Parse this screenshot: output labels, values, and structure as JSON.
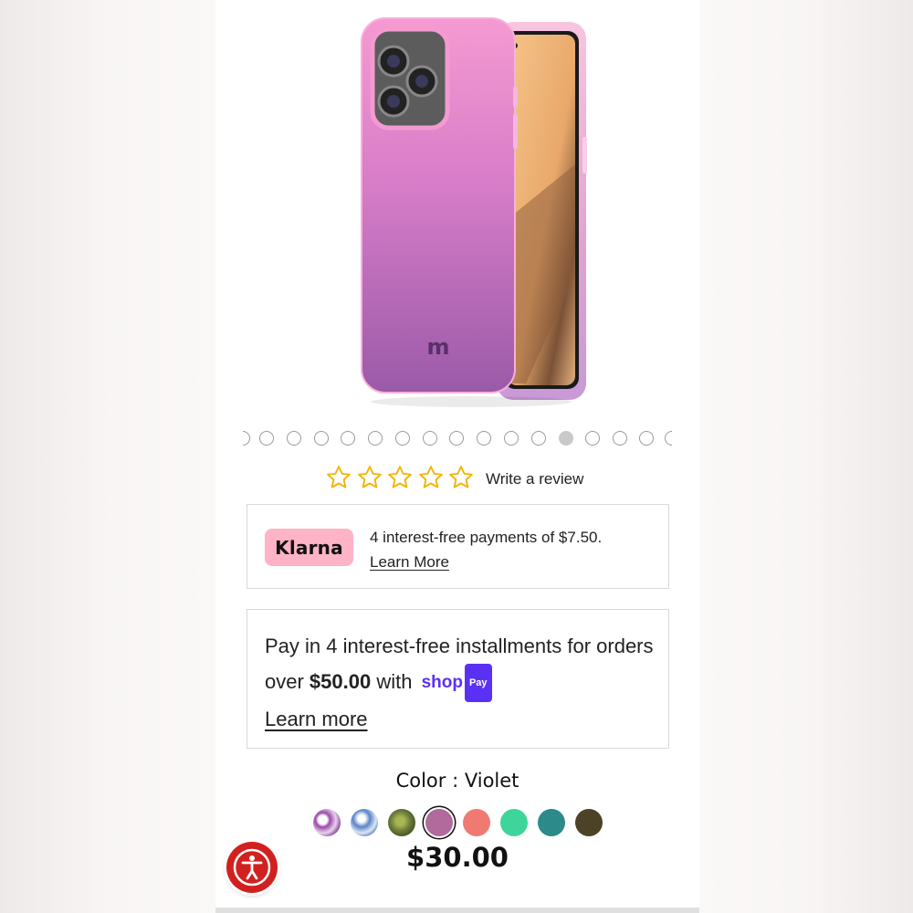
{
  "product": {
    "image_icon": "phone-case-image"
  },
  "carousel": {
    "total_dots": 15,
    "active_index": 11
  },
  "rating": {
    "stars": 5,
    "filled": 0,
    "star_color": "#f2b400",
    "review_link": "Write a review"
  },
  "klarna": {
    "logo": "Klarna",
    "text": "4 interest-free payments of $7.50.",
    "learn_more": "Learn More",
    "brand_color": "#ffb3c7"
  },
  "shop_pay": {
    "text_pre": "Pay in 4 interest-free installments for orders over ",
    "amount": "$50.00",
    "text_mid": " with ",
    "shop_word": "shop",
    "pay_badge": "Pay",
    "learn_more": "Learn more",
    "brand_color": "#5a31f4"
  },
  "color": {
    "label": "Color : Violet",
    "swatches": [
      {
        "name": "purple-marble",
        "color": "#9b4aa8"
      },
      {
        "name": "blue-marble",
        "color": "#5b84c8"
      },
      {
        "name": "green-marble",
        "color": "#6f7f3a"
      },
      {
        "name": "violet",
        "color": "#b06a9c"
      },
      {
        "name": "coral",
        "color": "#ef7a72"
      },
      {
        "name": "mint",
        "color": "#3dd59a"
      },
      {
        "name": "teal",
        "color": "#2c8a8a"
      },
      {
        "name": "brown",
        "color": "#4c4326"
      }
    ],
    "selected_index": 3
  },
  "price": "$30.00",
  "accessibility": {
    "icon": "accessibility-icon",
    "color": "#d1211f"
  }
}
